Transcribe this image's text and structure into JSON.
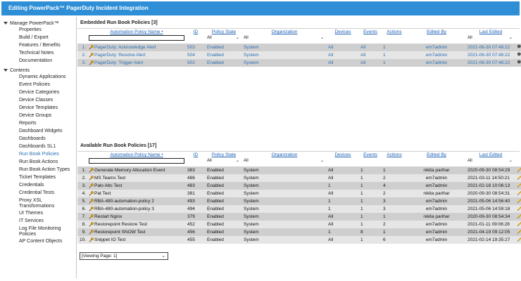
{
  "window": {
    "title": "Editing PowerPack™   PagerDuty Incident Integration"
  },
  "sidebar": {
    "group1": "Manage PowerPack™",
    "group1_items": [
      "Properties",
      "Build / Export",
      "Features / Benefits",
      "Technical Notes",
      "Documentation"
    ],
    "group2": "Contents",
    "group2_items": [
      "Dynamic Applications",
      "Event Policies",
      "Device Categories",
      "Device Classes",
      "Device Templates",
      "Device Groups",
      "Reports",
      "Dashboard Widgets",
      "Dashboards",
      "Dashboards SL1",
      "Run Book Policies",
      "Run Book Actions",
      "Run Book Action Types",
      "Ticket Templates",
      "Credentials",
      "Credential Tests",
      "Proxy XSL Transformations",
      "UI Themes",
      "IT Services",
      "Log File Monitoring Policies",
      "AP Content Objects"
    ],
    "active_item": "Run Book Policies"
  },
  "embedded": {
    "title": "Embedded Run Book Policies [3]",
    "headers": [
      "Automation Policy Name •",
      "ID",
      "Policy State",
      "Organization",
      "Devices",
      "Events",
      "Actions",
      "Edited By",
      "Last Edited"
    ],
    "filter": {
      "state": "All",
      "org": "All",
      "edited": "All"
    },
    "rows": [
      {
        "n": "1.",
        "name": "PagerDuty: Acknowledge Alert",
        "id": "503",
        "state": "Enabled",
        "org": "System",
        "devices": "All",
        "events": "All",
        "actions": "1",
        "by": "em7admin",
        "date": "2021-06-30 07:48:22"
      },
      {
        "n": "2.",
        "name": "PagerDuty: Resolve Alert",
        "id": "504",
        "state": "Enabled",
        "org": "System",
        "devices": "All",
        "events": "All",
        "actions": "1",
        "by": "em7admin",
        "date": "2021-06-30 07:48:22"
      },
      {
        "n": "3.",
        "name": "PagerDuty: Trigger Alert",
        "id": "502",
        "state": "Enabled",
        "org": "System",
        "devices": "All",
        "events": "All",
        "actions": "1",
        "by": "em7admin",
        "date": "2021-06-30 07:48:22"
      }
    ]
  },
  "available": {
    "title": "Available Run Book Policies [17]",
    "headers": [
      "Automation Policy Name •",
      "ID",
      "Policy State",
      "Organization",
      "Devices",
      "Events",
      "Actions",
      "Edited By",
      "Last Edited"
    ],
    "filter": {
      "state": "All",
      "org": "All",
      "edited": "All"
    },
    "rows": [
      {
        "n": "1.",
        "name": "Generate Memory Allocation Event",
        "id": "383",
        "state": "Enabled",
        "org": "System",
        "devices": "All",
        "events": "1",
        "actions": "1",
        "by": "nikita parihar",
        "date": "2020-09-30 08:54:29"
      },
      {
        "n": "2.",
        "name": "MS Teams Test",
        "id": "486",
        "state": "Enabled",
        "org": "System",
        "devices": "All",
        "events": "1",
        "actions": "2",
        "by": "em7admin",
        "date": "2021-03-11 14:50:21"
      },
      {
        "n": "3.",
        "name": "Palo Alto Test",
        "id": "483",
        "state": "Enabled",
        "org": "System",
        "devices": "1",
        "events": "1",
        "actions": "4",
        "by": "em7admin",
        "date": "2021-02-18 10:06:13"
      },
      {
        "n": "4.",
        "name": "Pat Test",
        "id": "381",
        "state": "Enabled",
        "org": "System",
        "devices": "All",
        "events": "1",
        "actions": "2",
        "by": "nikita parihar",
        "date": "2020-09-30 08:54:31"
      },
      {
        "n": "5.",
        "name": "RBA-480-automation-policy 2",
        "id": "493",
        "state": "Enabled",
        "org": "System",
        "devices": "1",
        "events": "1",
        "actions": "3",
        "by": "em7admin",
        "date": "2021-05-06 14:56:40"
      },
      {
        "n": "6.",
        "name": "RBA-480-automation-policy 3",
        "id": "494",
        "state": "Enabled",
        "org": "System",
        "devices": "1",
        "events": "1",
        "actions": "3",
        "by": "em7admin",
        "date": "2021-05-06 14:59:18"
      },
      {
        "n": "7.",
        "name": "Restart Nginx",
        "id": "379",
        "state": "Enabled",
        "org": "System",
        "devices": "All",
        "events": "1",
        "actions": "1",
        "by": "nikita parihar",
        "date": "2020-09-30 08:54:34"
      },
      {
        "n": "8.",
        "name": "Restorepoint Restore Test",
        "id": "452",
        "state": "Enabled",
        "org": "System",
        "devices": "All",
        "events": "1",
        "actions": "2",
        "by": "em7admin",
        "date": "2021-01-11 09:06:28"
      },
      {
        "n": "9.",
        "name": "Restorepoint SNOW Test",
        "id": "456",
        "state": "Enabled",
        "org": "System",
        "devices": "1",
        "events": "8",
        "actions": "1",
        "by": "em7admin",
        "date": "2021-04-19 09:12:05"
      },
      {
        "n": "10.",
        "name": "Snippet IO Test",
        "id": "455",
        "state": "Enabled",
        "org": "System",
        "devices": "All",
        "events": "1",
        "actions": "6",
        "by": "em7admin",
        "date": "2021-02-14 19:35:27"
      }
    ]
  },
  "pager": {
    "label": "[Viewing Page: 1]"
  },
  "icons": {
    "key": "key-icon",
    "pencil": "pencil-icon",
    "remove": "remove-icon"
  },
  "colors": {
    "title_bar": "#2f8fd6",
    "link": "#1a5fb4",
    "row_dark": "#cfcfcf",
    "row_light": "#e6e6e6"
  }
}
